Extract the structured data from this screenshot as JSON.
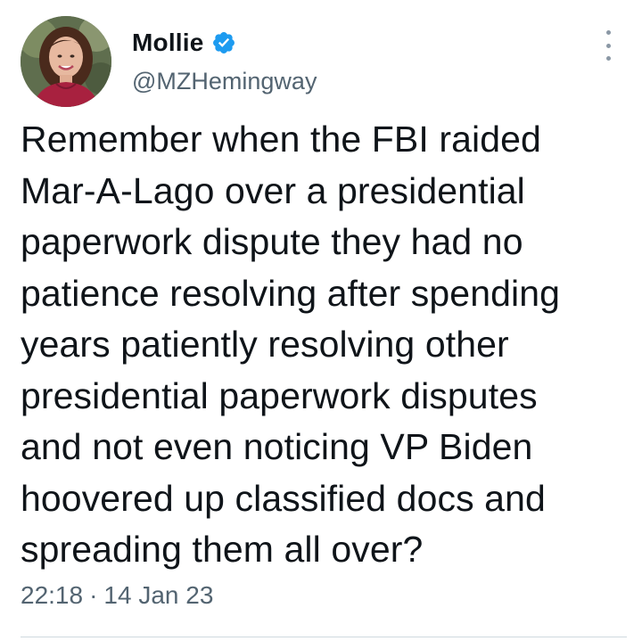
{
  "author": {
    "display_name": "Mollie",
    "handle": "@MZHemingway",
    "verified": true,
    "avatar_icon": "profile-photo"
  },
  "tweet": {
    "lines": [
      "Remember when the FBI raided",
      "Mar-A-Lago over a presidential",
      "paperwork dispute they had no",
      "patience resolving after spending",
      "years patiently resolving other",
      "presidential paperwork disputes",
      "and not even noticing VP Biden",
      "hoovered up classified docs and",
      "spreading them all over?"
    ]
  },
  "meta": {
    "time": "22:18",
    "separator": "·",
    "date": "14 Jan 23"
  },
  "icons": {
    "verified": "verified-badge-icon",
    "more": "more-options-icon"
  },
  "colors": {
    "verified_blue": "#1d9bf0",
    "text_primary": "#0f1419",
    "text_secondary": "#536471",
    "divider": "#cfd9de"
  }
}
